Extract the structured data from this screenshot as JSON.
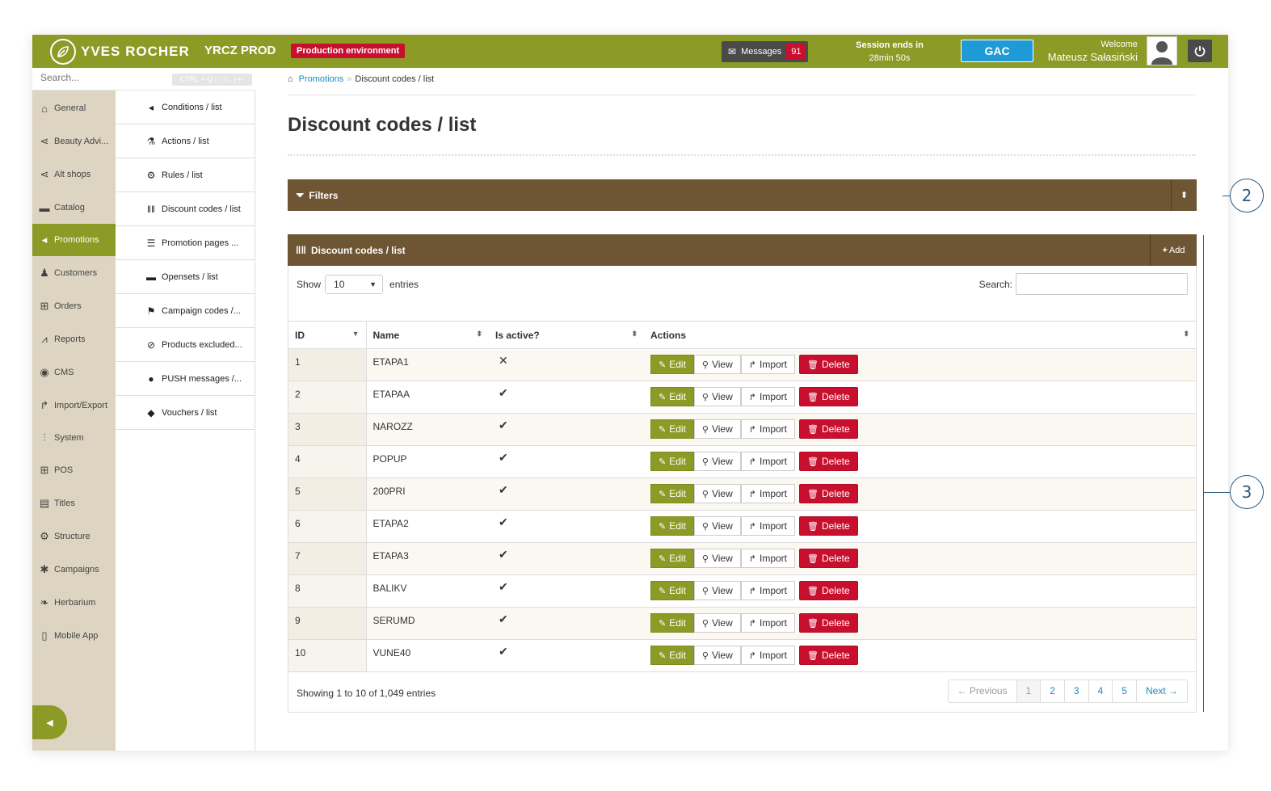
{
  "header": {
    "logo_text": "YVES ROCHER",
    "env_name": "YRCZ PROD",
    "env_badge": "Production environment",
    "messages_label": "Messages",
    "messages_count": "91",
    "session_label": "Session ends in",
    "session_time": "28min 50s",
    "gac_label": "GAC",
    "welcome_label": "Welcome",
    "user_name": "Mateusz Sałasiński"
  },
  "sidebar": {
    "search_placeholder": "Search...",
    "search_shortcut": "CTRL + Q | ↑ / ↓ | ↵",
    "items": [
      {
        "label": "General",
        "icon": "home-icon"
      },
      {
        "label": "Beauty Advi...",
        "icon": "share-icon"
      },
      {
        "label": "Alt shops",
        "icon": "share-icon"
      },
      {
        "label": "Catalog",
        "icon": "folder-icon"
      },
      {
        "label": "Promotions",
        "icon": "bullhorn-icon"
      },
      {
        "label": "Customers",
        "icon": "users-icon"
      },
      {
        "label": "Orders",
        "icon": "cart-icon"
      },
      {
        "label": "Reports",
        "icon": "chart-icon"
      },
      {
        "label": "CMS",
        "icon": "globe-icon"
      },
      {
        "label": "Import/Export",
        "icon": "share-arrow-icon"
      },
      {
        "label": "System",
        "icon": "sliders-icon"
      },
      {
        "label": "POS",
        "icon": "cart-icon"
      },
      {
        "label": "Titles",
        "icon": "list-alt-icon"
      },
      {
        "label": "Structure",
        "icon": "cogs-icon"
      },
      {
        "label": "Campaigns",
        "icon": "asterisk-icon"
      },
      {
        "label": "Herbarium",
        "icon": "leaf-icon"
      },
      {
        "label": "Mobile App",
        "icon": "mobile-icon"
      }
    ]
  },
  "submenu": {
    "items": [
      {
        "label": "Conditions / list",
        "icon": "bullhorn-icon"
      },
      {
        "label": "Actions / list",
        "icon": "flask-icon"
      },
      {
        "label": "Rules / list",
        "icon": "cogs-icon"
      },
      {
        "label": "Discount codes / list",
        "icon": "barcode-icon"
      },
      {
        "label": "Promotion pages ...",
        "icon": "list-icon"
      },
      {
        "label": "Opensets / list",
        "icon": "folder-icon"
      },
      {
        "label": "Campaign codes /...",
        "icon": "flag-icon"
      },
      {
        "label": "Products excluded...",
        "icon": "ban-icon"
      },
      {
        "label": "PUSH messages /...",
        "icon": "comment-icon"
      },
      {
        "label": "Vouchers / list",
        "icon": "tag-icon"
      }
    ]
  },
  "breadcrumb": {
    "parent": "Promotions",
    "current": "Discount codes / list"
  },
  "page": {
    "title": "Discount codes / list"
  },
  "filters": {
    "title": "Filters"
  },
  "list": {
    "title": "Discount codes / list",
    "add_label": "Add",
    "show_label": "Show",
    "show_value": "10",
    "entries_label": "entries",
    "search_label": "Search:",
    "columns": [
      "ID",
      "Name",
      "Is active?",
      "Actions"
    ],
    "rows": [
      {
        "id": "1",
        "name": "ETAPA1",
        "active": "✕"
      },
      {
        "id": "2",
        "name": "ETAPAA",
        "active": "✔"
      },
      {
        "id": "3",
        "name": "NAROZZ",
        "active": "✔"
      },
      {
        "id": "4",
        "name": "POPUP",
        "active": "✔"
      },
      {
        "id": "5",
        "name": "200PRI",
        "active": "✔"
      },
      {
        "id": "6",
        "name": "ETAPA2",
        "active": "✔"
      },
      {
        "id": "7",
        "name": "ETAPA3",
        "active": "✔"
      },
      {
        "id": "8",
        "name": "BALIKV",
        "active": "✔"
      },
      {
        "id": "9",
        "name": "SERUMD",
        "active": "✔"
      },
      {
        "id": "10",
        "name": "VUNE40",
        "active": "✔"
      }
    ],
    "actions": {
      "edit": "Edit",
      "view": "View",
      "import": "Import",
      "delete": "Delete"
    },
    "info": "Showing 1 to 10 of 1,049 entries",
    "pager": {
      "previous": "← Previous",
      "pages": [
        "1",
        "2",
        "3",
        "4",
        "5"
      ],
      "next": "Next →"
    }
  },
  "callouts": [
    "2",
    "3"
  ],
  "colors": {
    "accent": "#8c9a26",
    "panel": "#6e5634",
    "danger": "#c8102e",
    "info": "#1e9ad6"
  }
}
